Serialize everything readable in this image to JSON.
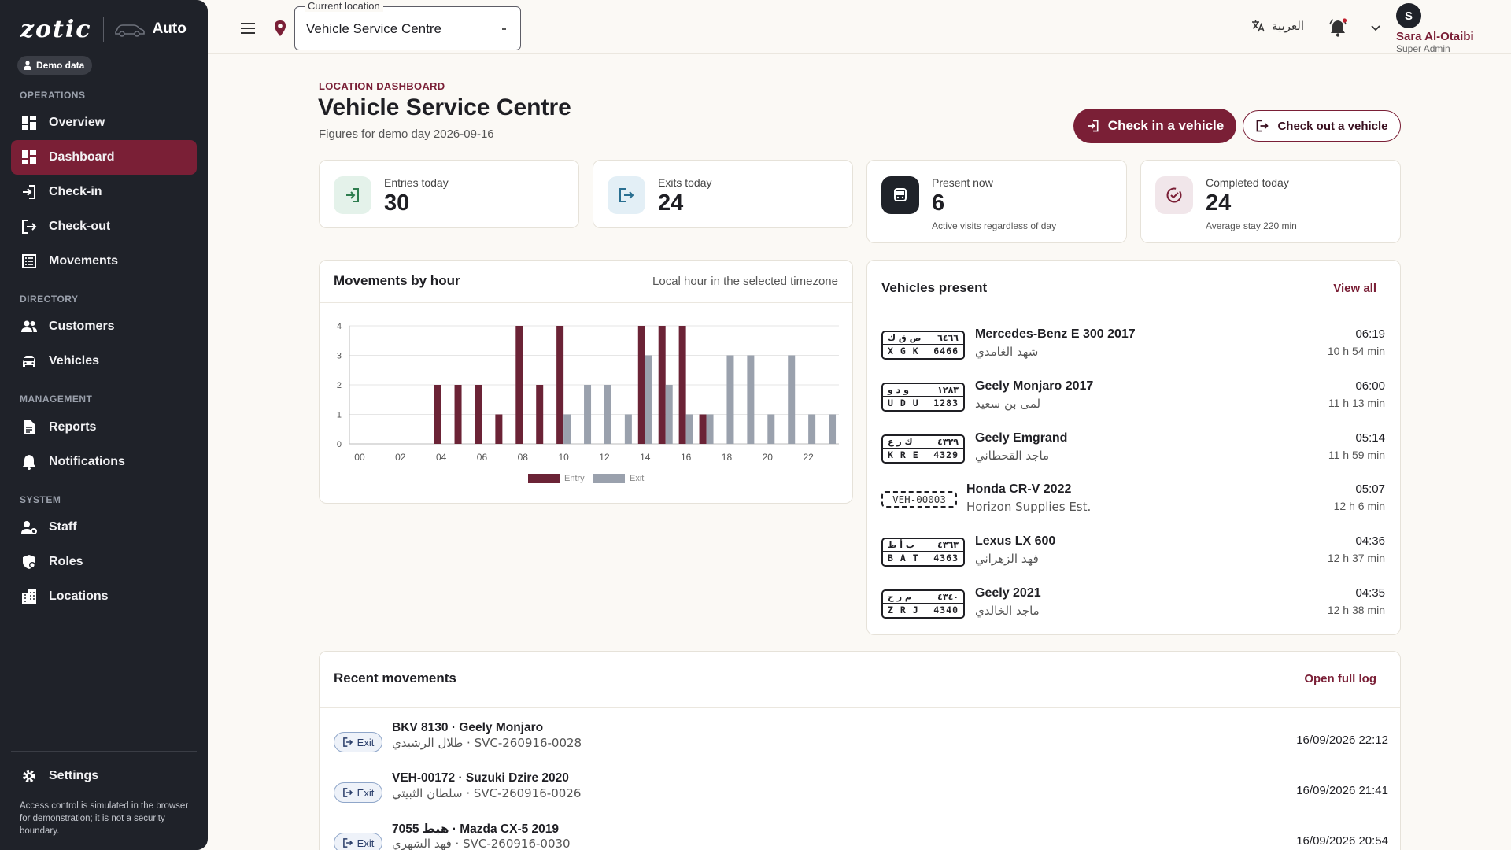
{
  "brand": {
    "logo": "zotic",
    "product": "Auto"
  },
  "demo_badge": "Demo data",
  "sidebar": {
    "sections": [
      {
        "label": "OPERATIONS"
      },
      {
        "label": "DIRECTORY"
      },
      {
        "label": "MANAGEMENT"
      },
      {
        "label": "SYSTEM"
      }
    ],
    "items": [
      {
        "label": "Overview",
        "icon": "grid-icon"
      },
      {
        "label": "Dashboard",
        "icon": "dashboard-icon",
        "active": true
      },
      {
        "label": "Check-in",
        "icon": "login-icon"
      },
      {
        "label": "Check-out",
        "icon": "logout-icon"
      },
      {
        "label": "Movements",
        "icon": "list-icon"
      },
      {
        "label": "Customers",
        "icon": "people-icon"
      },
      {
        "label": "Vehicles",
        "icon": "car-icon"
      },
      {
        "label": "Reports",
        "icon": "report-icon"
      },
      {
        "label": "Notifications",
        "icon": "bell-icon"
      },
      {
        "label": "Staff",
        "icon": "staff-icon"
      },
      {
        "label": "Roles",
        "icon": "shield-icon"
      },
      {
        "label": "Locations",
        "icon": "building-icon"
      }
    ],
    "settings_label": "Settings",
    "footer_note": "Access control is simulated in the browser for demonstration; it is not a security boundary."
  },
  "topbar": {
    "location_legend": "Current location",
    "location_value": "Vehicle Service Centre",
    "language": "العربية",
    "user_initial": "S",
    "user_name": "Sara Al-Otaibi",
    "user_role": "Super Admin"
  },
  "header": {
    "kicker": "LOCATION DASHBOARD",
    "title": "Vehicle Service Centre",
    "subtitle": "Figures for demo day 2026-09-16",
    "checkin_button": "Check in a vehicle",
    "checkout_button": "Check out a vehicle"
  },
  "stats": [
    {
      "label": "Entries today",
      "value": "30",
      "extra": "",
      "icon": "entry-icon"
    },
    {
      "label": "Exits today",
      "value": "24",
      "extra": "",
      "icon": "exit-icon"
    },
    {
      "label": "Present now",
      "value": "6",
      "extra": "Active visits regardless of day",
      "icon": "vehicle-icon"
    },
    {
      "label": "Completed today",
      "value": "24",
      "extra": "Average stay 220 min",
      "icon": "check-circle-icon"
    }
  ],
  "chart_data": {
    "type": "bar",
    "title": "Movements by hour",
    "subtitle": "Local hour in the selected timezone",
    "x": [
      0,
      1,
      2,
      3,
      4,
      5,
      6,
      7,
      8,
      9,
      10,
      11,
      12,
      13,
      14,
      15,
      16,
      17,
      18,
      19,
      20,
      21,
      22,
      23
    ],
    "tick_labels": [
      "00",
      "02",
      "04",
      "06",
      "08",
      "10",
      "12",
      "14",
      "16",
      "18",
      "20",
      "22"
    ],
    "ylim": [
      0,
      4
    ],
    "yticks": [
      0,
      1,
      2,
      3,
      4
    ],
    "grid": true,
    "legend": "bottom",
    "series": [
      {
        "name": "Entry",
        "color": "#6b2336",
        "values": [
          0,
          0,
          0,
          0,
          2,
          2,
          2,
          1,
          4,
          2,
          4,
          0,
          0,
          0,
          4,
          4,
          4,
          1,
          0,
          0,
          0,
          0,
          0,
          0
        ]
      },
      {
        "name": "Exit",
        "color": "#9aa1ad",
        "values": [
          0,
          0,
          0,
          0,
          0,
          0,
          0,
          0,
          0,
          0,
          1,
          2,
          2,
          1,
          3,
          2,
          1,
          1,
          3,
          3,
          1,
          3,
          1,
          1
        ]
      }
    ]
  },
  "vehicles_present": {
    "title": "Vehicles present",
    "view_all": "View all",
    "rows": [
      {
        "plate_ar_letters": "ص ق ك",
        "plate_ar_digits": "٦٤٦٦",
        "plate_letters": "X G K",
        "plate_digits": "6466",
        "name": "Mercedes-Benz E 300 2017",
        "owner": "شهد الغامدي",
        "time": "06:19",
        "duration": "10 h 54 min"
      },
      {
        "plate_ar_letters": "و د و",
        "plate_ar_digits": "١٢٨٣",
        "plate_letters": "U D U",
        "plate_digits": "1283",
        "name": "Geely Monjaro 2017",
        "owner": "لمى بن سعيد",
        "time": "06:00",
        "duration": "11 h 13 min"
      },
      {
        "plate_ar_letters": "ك ر ع",
        "plate_ar_digits": "٤٣٢٩",
        "plate_letters": "K R E",
        "plate_digits": "4329",
        "name": "Geely Emgrand",
        "owner": "ماجد القحطاني",
        "time": "05:14",
        "duration": "11 h 59 min"
      },
      {
        "temp_plate": "VEH-00003",
        "name": "Honda CR-V 2022",
        "owner": "Horizon Supplies Est.",
        "time": "05:07",
        "duration": "12 h 6 min"
      },
      {
        "plate_ar_letters": "ب أ ط",
        "plate_ar_digits": "٤٣٦٣",
        "plate_letters": "B A T",
        "plate_digits": "4363",
        "name": "Lexus LX 600",
        "owner": "فهد الزهراني",
        "time": "04:36",
        "duration": "12 h 37 min"
      },
      {
        "plate_ar_letters": "م ر ج",
        "plate_ar_digits": "٤٣٤٠",
        "plate_letters": "Z R J",
        "plate_digits": "4340",
        "name": "Geely 2021",
        "owner": "ماجد الخالدي",
        "time": "04:35",
        "duration": "12 h 38 min"
      }
    ]
  },
  "recent_movements": {
    "title": "Recent movements",
    "open_log": "Open full log",
    "rows": [
      {
        "type": "Exit",
        "title": "BKV 8130 · Geely Monjaro",
        "sub": "طلال الرشيدي · SVC-260916-0028",
        "datetime": "16/09/2026 22:12"
      },
      {
        "type": "Exit",
        "title": "VEH-00172 · Suzuki Dzire 2020",
        "sub": "سلطان الثبيتي · SVC-260916-0026",
        "datetime": "16/09/2026 21:41"
      },
      {
        "type": "Exit",
        "title": "7055 هبط · Mazda CX-5 2019",
        "sub": "فهد الشهري · SVC-260916-0030",
        "datetime": "16/09/2026 20:54"
      }
    ]
  },
  "colors": {
    "brand": "#7a1f36",
    "sidebar_bg": "#1f2229",
    "entry": "#6b2336",
    "exit": "#9aa1ad"
  }
}
